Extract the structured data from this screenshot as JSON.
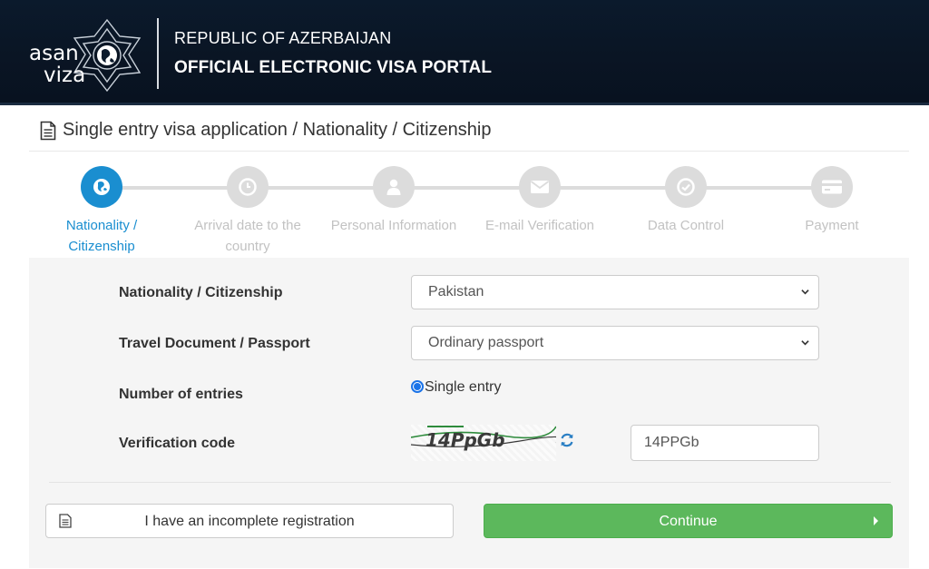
{
  "header": {
    "logo_line1": "asan",
    "logo_line2": "viza",
    "title_line1": "REPUBLIC OF AZERBAIJAN",
    "title_line2": "OFFICIAL ELECTRONIC VISA PORTAL"
  },
  "page": {
    "title": "Single entry visa application / Nationality / Citizenship"
  },
  "stepper": {
    "steps": [
      {
        "line1": "Nationality /",
        "line2": "Citizenship",
        "icon": "globe-icon",
        "active": true
      },
      {
        "line1": "Arrival date to the",
        "line2": "country",
        "icon": "clock-icon",
        "active": false
      },
      {
        "line1": "Personal Information",
        "line2": "",
        "icon": "user-icon",
        "active": false
      },
      {
        "line1": "E-mail Verification",
        "line2": "",
        "icon": "envelope-icon",
        "active": false
      },
      {
        "line1": "Data Control",
        "line2": "",
        "icon": "check-circle-icon",
        "active": false
      },
      {
        "line1": "Payment",
        "line2": "",
        "icon": "credit-card-icon",
        "active": false
      }
    ],
    "active_color": "#1a8ed0",
    "inactive_color": "#dcdcdc"
  },
  "form": {
    "nationality_label": "Nationality / Citizenship",
    "nationality_value": "Pakistan",
    "document_label": "Travel Document / Passport",
    "document_value": "Ordinary passport",
    "entries_label": "Number of entries",
    "entries_option": "Single entry",
    "verification_label": "Verification code",
    "captcha_text": "14PpGb",
    "verification_value": "14PPGb"
  },
  "actions": {
    "incomplete_label": "I have an incomplete registration",
    "continue_label": "Continue",
    "continue_color": "#5cb85c"
  }
}
